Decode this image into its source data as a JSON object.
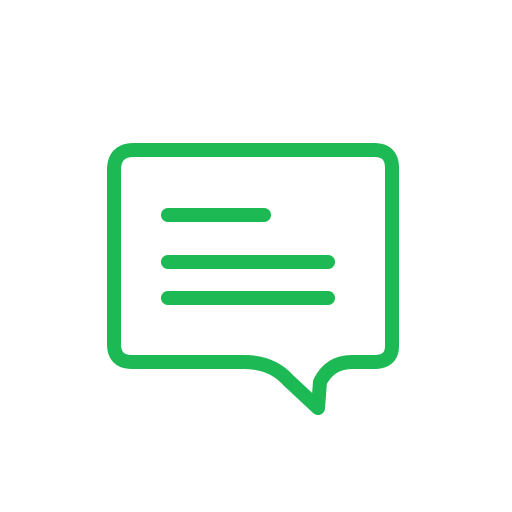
{
  "icon": {
    "name": "comment-icon",
    "color": "#1DB954",
    "background": "#FFFFFF"
  }
}
